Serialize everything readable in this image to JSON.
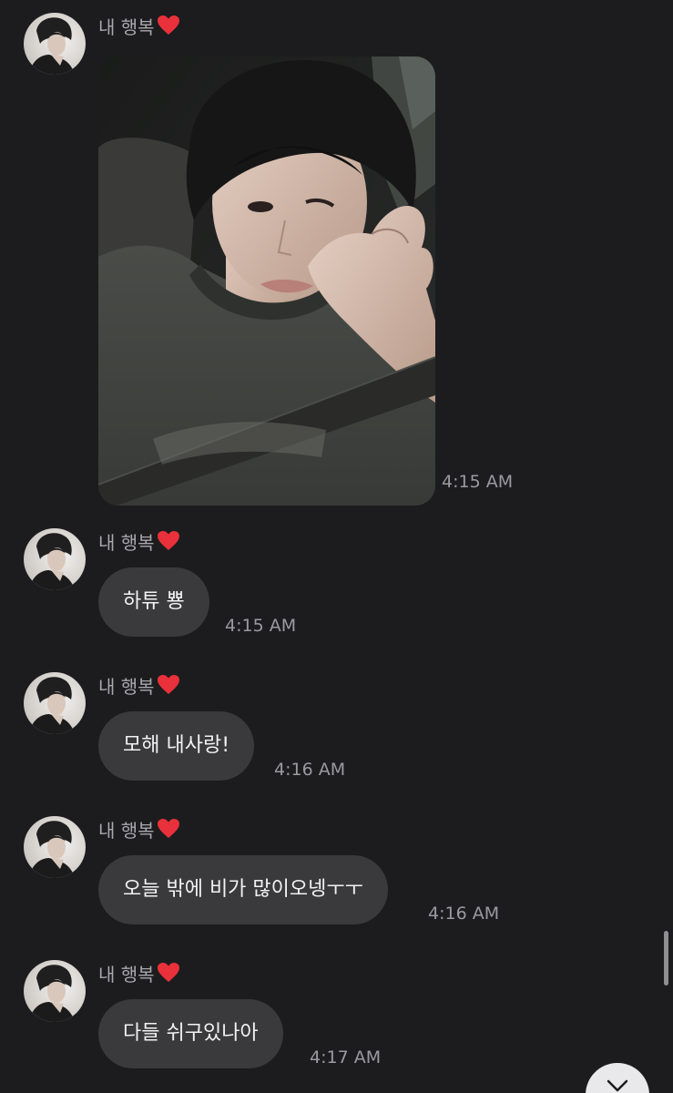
{
  "sender_name": "내 행복",
  "messages": [
    {
      "type": "photo",
      "time": "4:15 AM"
    },
    {
      "type": "text",
      "text": "하튜 뿅",
      "time": "4:15 AM"
    },
    {
      "type": "text",
      "text": "모해 내사랑!",
      "time": "4:16 AM"
    },
    {
      "type": "text",
      "text": "오늘 밖에 비가 많이오넹ㅜㅜ",
      "time": "4:16 AM"
    },
    {
      "type": "text",
      "text": "다들 쉬구있나아",
      "time": "4:17 AM"
    }
  ],
  "icons": {
    "heart": "heart-icon",
    "scroll_down": "chevron-down-icon"
  },
  "colors": {
    "background": "#1c1c1e",
    "bubble": "#3a3a3d",
    "heart": "#e8313b"
  }
}
